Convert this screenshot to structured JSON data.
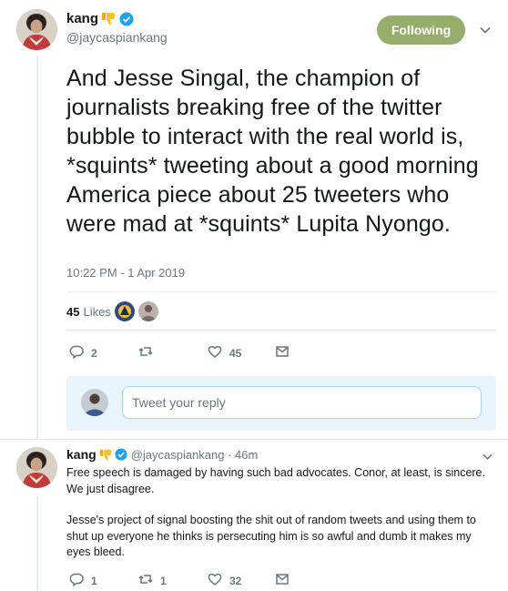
{
  "tweet": {
    "display_name": "kang",
    "handle": "@jaycaspiankang",
    "follow_label": "Following",
    "text": "And Jesse Singal, the champion of journalists breaking free of the twitter bubble to interact with the real world is, *squints* tweeting about a good morning America piece about 25 tweeters who were mad at *squints* Lupita Nyongo.",
    "timestamp": "10:22 PM - 1 Apr 2019",
    "likes_count": "45",
    "likes_label": "Likes",
    "actions": {
      "replies": "2",
      "retweets": "",
      "likes": "45"
    }
  },
  "reply_box": {
    "placeholder": "Tweet your reply"
  },
  "reply": {
    "display_name": "kang",
    "handle_time": "@jaycaspiankang · 46m",
    "paragraph_1": "Free speech is damaged by having such bad advocates. Conor, at least, is sincere. We just disagree.",
    "paragraph_2": "Jesse's project of signal boosting the shit out of random tweets and using them to shut up everyone he thinks is persecuting him is so awful and dumb it makes my eyes bleed.",
    "actions": {
      "replies": "1",
      "retweets": "1",
      "likes": "32"
    }
  },
  "colors": {
    "follow_button": "#97ad6b",
    "verified": "#1da1f2",
    "muted": "#657786",
    "reply_box_bg": "#e8f5fd"
  },
  "icons": [
    "thumbs-down-emoji",
    "verified-badge",
    "chevron-down-icon",
    "reply-icon",
    "retweet-icon",
    "heart-icon",
    "message-icon"
  ]
}
